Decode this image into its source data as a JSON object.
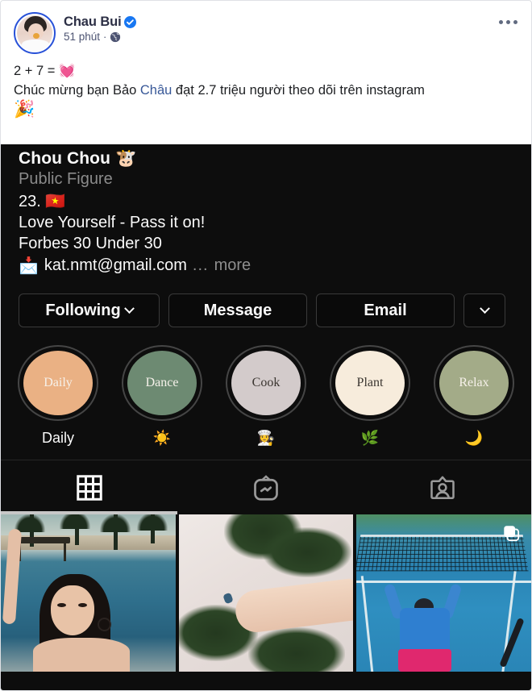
{
  "post": {
    "author_name": "Chau Bui",
    "verified_icon": "verified-badge-icon",
    "timestamp": "51 phút",
    "meta_separator": "·",
    "privacy_icon": "globe-icon",
    "menu_icon": "more-options-icon",
    "text_line_1": "2 + 7 = ",
    "text_line_1_emoji": "💓",
    "text_line_2_a": "Chúc mừng bạn Bảo ",
    "text_line_2_link": "Châu",
    "text_line_2_b": " đạt 2.7 triệu người theo dõi trên instagram",
    "text_line_3_emoji": "🎉",
    "author_name_color": "#2c2f45",
    "link_color": "#385898"
  },
  "instagram": {
    "username": "Chou Chou ",
    "username_emoji": "🐮",
    "category": "Public Figure",
    "bio_line_age": "23. ",
    "bio_line_age_emoji": "🇻🇳",
    "bio_line_motto": "Love Yourself - Pass it on!",
    "bio_line_forbes": "Forbes 30 Under 30",
    "bio_email_emoji": "📩",
    "bio_email": "kat.nmt@gmail.com",
    "bio_ellipsis": "...",
    "bio_more": "more",
    "background_color": "#0d0d0d",
    "actions": [
      {
        "label": "Following",
        "has_caret": true,
        "name": "following-button"
      },
      {
        "label": "Message",
        "has_caret": false,
        "name": "message-button"
      },
      {
        "label": "Email",
        "has_caret": false,
        "name": "email-button"
      },
      {
        "label": "",
        "has_caret": true,
        "name": "more-actions-button"
      }
    ],
    "highlights": [
      {
        "cover_text": "Daily",
        "label": "Daily",
        "color": "#eab184"
      },
      {
        "cover_text": "Dance",
        "label": "☀️",
        "color": "#6d8a72"
      },
      {
        "cover_text": "Cook",
        "label": "👩‍🍳",
        "color": "#d3cbcb"
      },
      {
        "cover_text": "Plant",
        "label": "🌿",
        "color": "#f7ecdc"
      },
      {
        "cover_text": "Relax",
        "label": "🌙",
        "color": "#a3ab88"
      }
    ],
    "tabs": [
      {
        "icon": "grid-posts-icon",
        "active": true
      },
      {
        "icon": "igtv-icon",
        "active": false
      },
      {
        "icon": "tagged-photos-icon",
        "active": false
      }
    ],
    "grid_photos": [
      {
        "name": "photo-pool-palms"
      },
      {
        "name": "photo-palms-hand"
      },
      {
        "name": "photo-tennis-court",
        "badge_icon": "carousel-multi-photo-icon"
      }
    ]
  }
}
